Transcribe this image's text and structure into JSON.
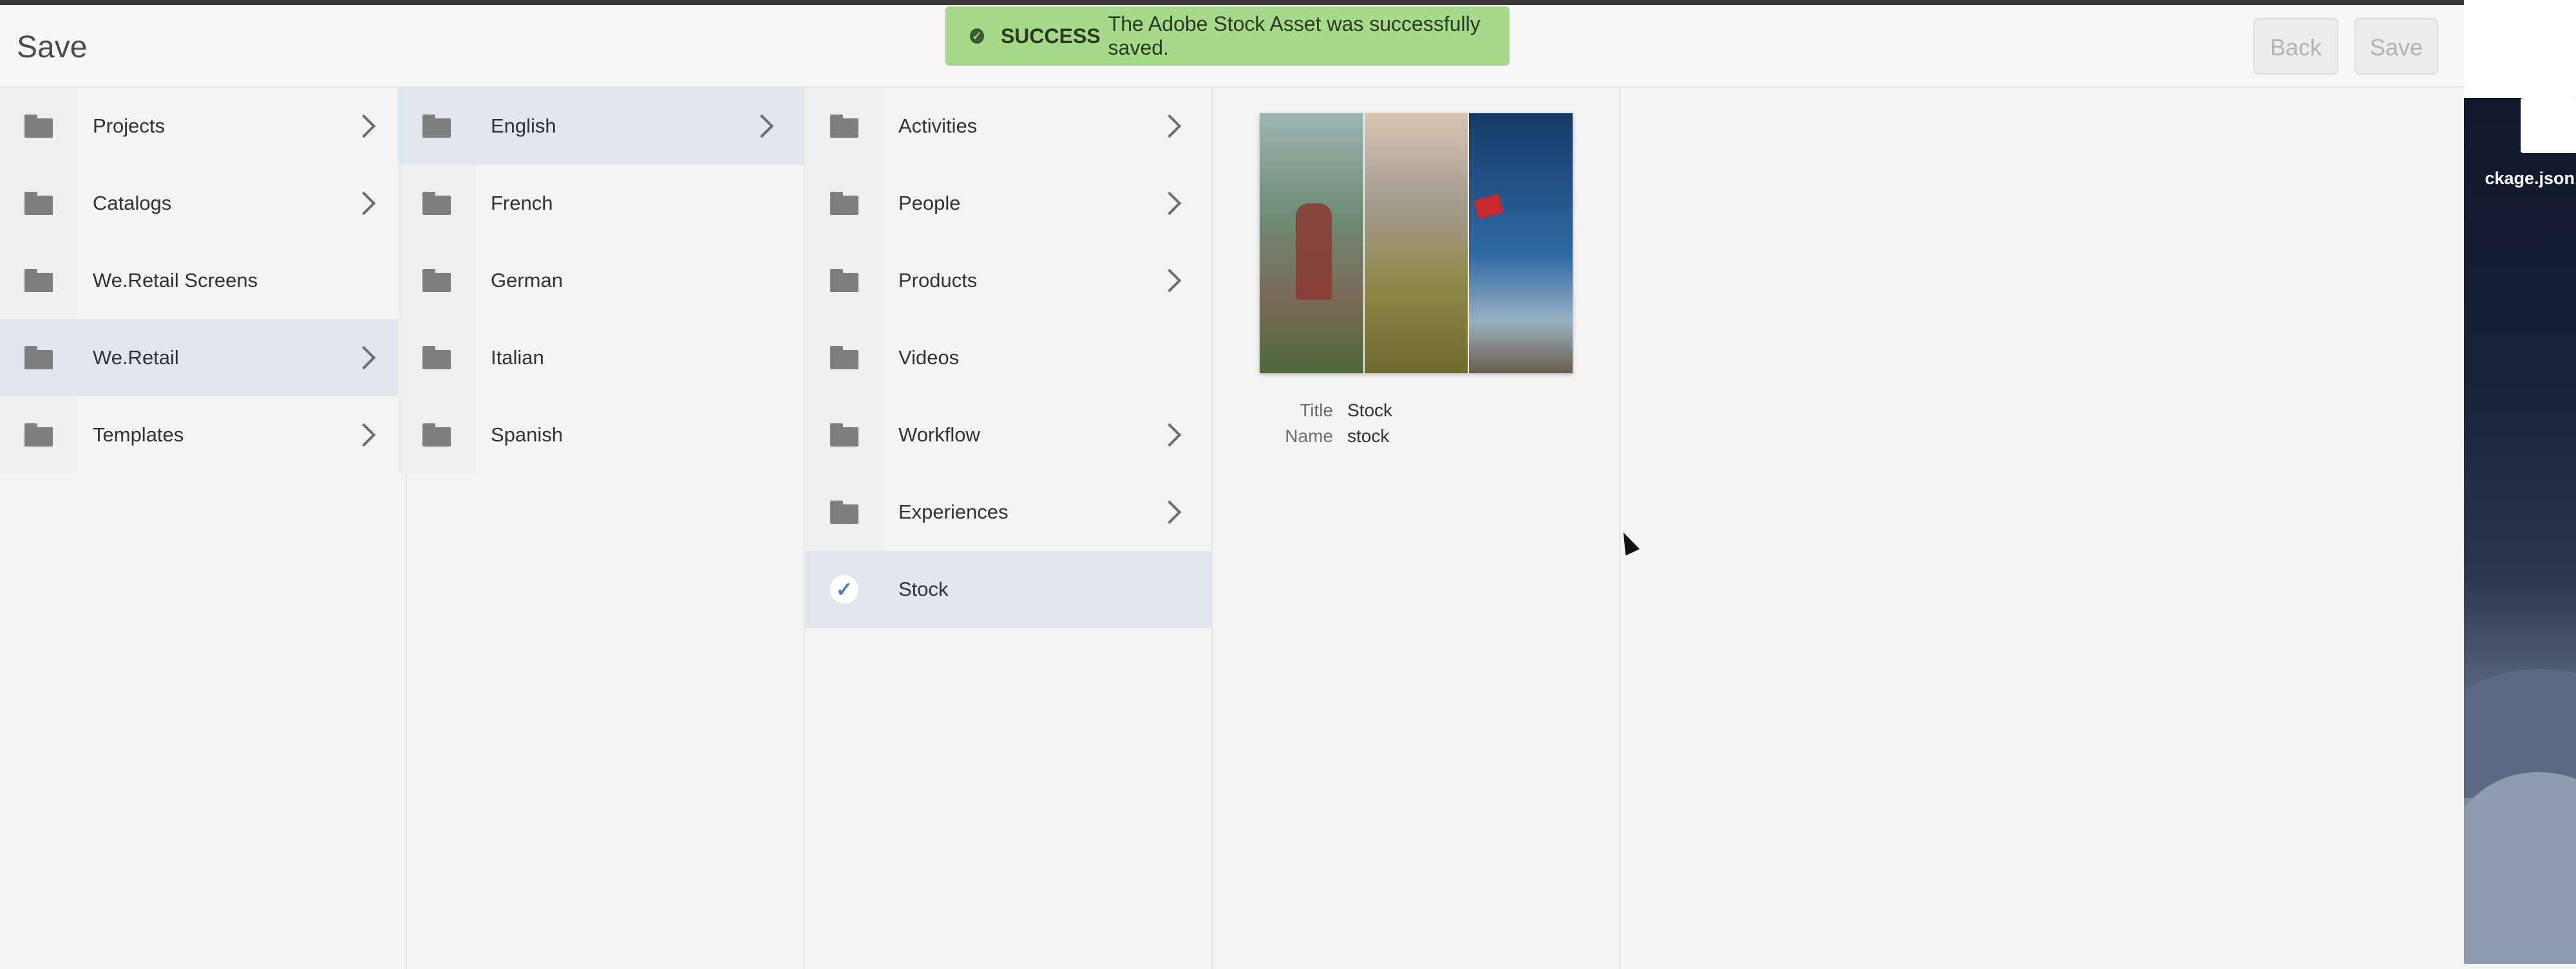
{
  "header": {
    "title": "Save",
    "back_label": "Back",
    "save_label": "Save"
  },
  "toast": {
    "status": "SUCCESS",
    "message": "The Adobe Stock Asset was successfully saved.",
    "icon": "check-circle-icon",
    "color": "#a7d98a"
  },
  "columns": [
    {
      "items": [
        {
          "label": "Projects",
          "has_children": true,
          "selected": false
        },
        {
          "label": "Catalogs",
          "has_children": true,
          "selected": false
        },
        {
          "label": "We.Retail Screens",
          "has_children": false,
          "selected": false
        },
        {
          "label": "We.Retail",
          "has_children": true,
          "selected": true
        },
        {
          "label": "Templates",
          "has_children": true,
          "selected": false
        }
      ]
    },
    {
      "items": [
        {
          "label": "English",
          "has_children": true,
          "selected": true
        },
        {
          "label": "French",
          "has_children": false,
          "selected": false
        },
        {
          "label": "German",
          "has_children": false,
          "selected": false
        },
        {
          "label": "Italian",
          "has_children": false,
          "selected": false
        },
        {
          "label": "Spanish",
          "has_children": false,
          "selected": false
        }
      ]
    },
    {
      "items": [
        {
          "label": "Activities",
          "has_children": true,
          "selected": false
        },
        {
          "label": "People",
          "has_children": true,
          "selected": false
        },
        {
          "label": "Products",
          "has_children": true,
          "selected": false
        },
        {
          "label": "Videos",
          "has_children": false,
          "selected": false
        },
        {
          "label": "Workflow",
          "has_children": true,
          "selected": false
        },
        {
          "label": "Experiences",
          "has_children": true,
          "selected": false
        },
        {
          "label": "Stock",
          "has_children": false,
          "selected": true,
          "checked": true
        }
      ]
    }
  ],
  "preview": {
    "title_key": "Title",
    "title_value": "Stock",
    "name_key": "Name",
    "name_value": "stock"
  },
  "desktop": {
    "file_label": "ckage.json"
  },
  "colors": {
    "selected_row": "#e1e5ed",
    "check_accent": "#4b7bd0"
  }
}
